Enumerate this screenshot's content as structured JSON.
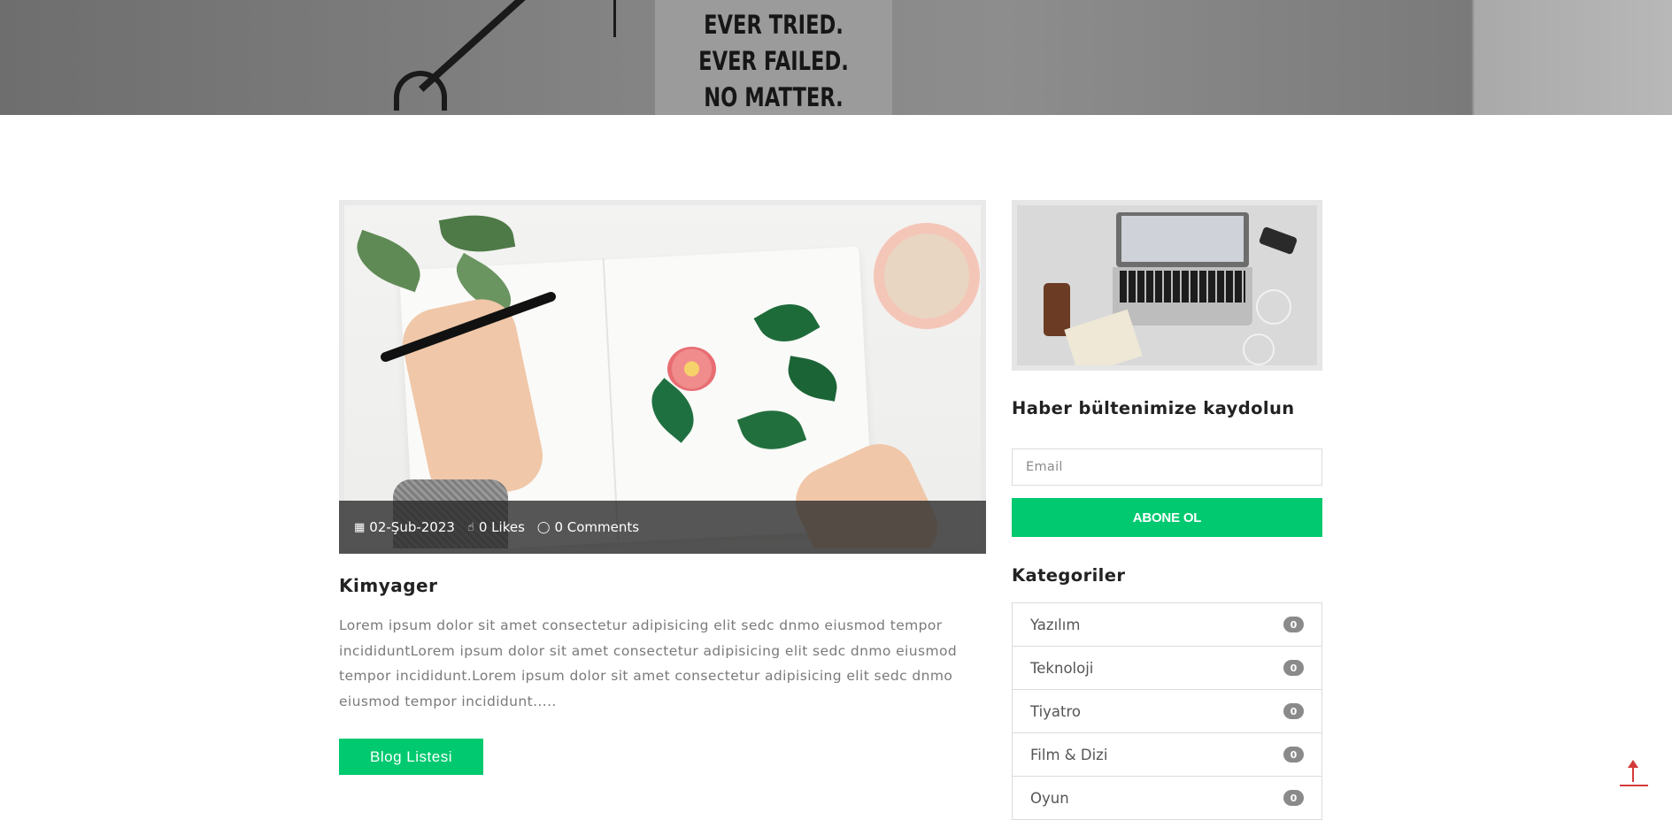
{
  "hero": {
    "poster_lines": [
      "EVER TRIED.",
      "EVER FAILED.",
      "NO MATTER."
    ]
  },
  "post": {
    "date": "02-Şub-2023",
    "likes": "0 Likes",
    "comments": "0 Comments",
    "title": "Kimyager",
    "excerpt": "Lorem ipsum dolor sit amet consectetur adipisicing elit sedc dnmo eiusmod tempor incididuntLorem ipsum dolor sit amet consectetur adipisicing elit sedc dnmo eiusmod tempor incididunt.Lorem ipsum dolor sit amet consectetur adipisicing elit sedc dnmo eiusmod tempor incididunt.....",
    "button_label": "Blog Listesi"
  },
  "sidebar": {
    "newsletter_title": "Haber bültenimize kaydolun",
    "email_placeholder": "Email",
    "subscribe_label": "ABONE OL",
    "categories_title": "Kategoriler",
    "categories": [
      {
        "name": "Yazılım",
        "count": "0"
      },
      {
        "name": "Teknoloji",
        "count": "0"
      },
      {
        "name": "Tiyatro",
        "count": "0"
      },
      {
        "name": "Film & Dizi",
        "count": "0"
      },
      {
        "name": "Oyun",
        "count": "0"
      }
    ]
  },
  "colors": {
    "accent": "#00c96f",
    "scroll_top": "#d43a3a",
    "badge": "#8a8a8a"
  },
  "icons": {
    "date": "calendar-icon",
    "likes": "thumbs-up-icon",
    "comments": "comment-icon",
    "scroll_top": "arrow-up-icon"
  }
}
